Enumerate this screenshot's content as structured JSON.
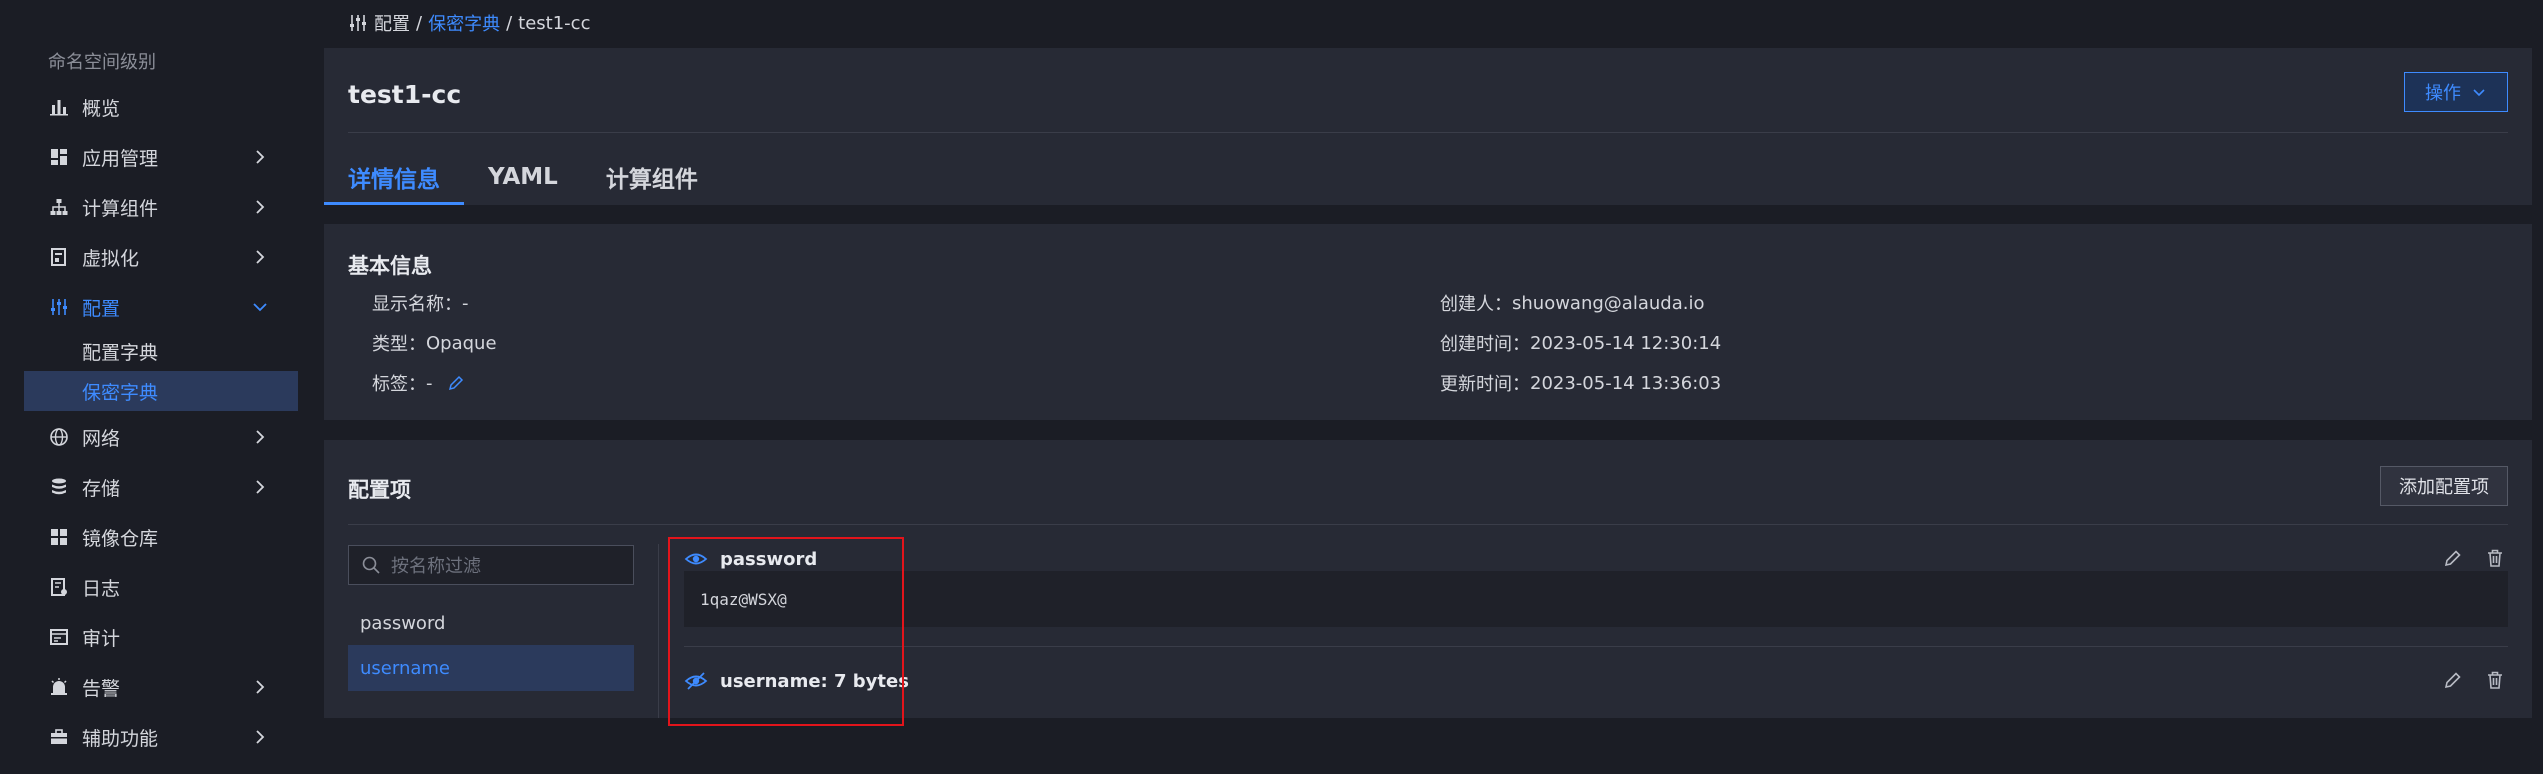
{
  "sidebar": {
    "section_title": "命名空间级别",
    "items": [
      {
        "label": "概览",
        "icon": "bar-chart-icon",
        "has_children": false
      },
      {
        "label": "应用管理",
        "icon": "apps-icon",
        "has_children": true
      },
      {
        "label": "计算组件",
        "icon": "hierarchy-icon",
        "has_children": true
      },
      {
        "label": "虚拟化",
        "icon": "virtualization-icon",
        "has_children": true
      },
      {
        "label": "配置",
        "icon": "sliders-icon",
        "has_children": true,
        "expanded": true,
        "active": true
      },
      {
        "label": "网络",
        "icon": "globe-icon",
        "has_children": true
      },
      {
        "label": "存储",
        "icon": "database-icon",
        "has_children": true
      },
      {
        "label": "镜像仓库",
        "icon": "grid-icon",
        "has_children": false
      },
      {
        "label": "日志",
        "icon": "log-icon",
        "has_children": false
      },
      {
        "label": "审计",
        "icon": "audit-icon",
        "has_children": false
      },
      {
        "label": "告警",
        "icon": "alarm-icon",
        "has_children": true
      },
      {
        "label": "辅助功能",
        "icon": "toolbox-icon",
        "has_children": true
      }
    ],
    "config_children": [
      {
        "label": "配置字典",
        "selected": false
      },
      {
        "label": "保密字典",
        "selected": true
      }
    ]
  },
  "breadcrumb": {
    "root": "配置",
    "link": "保密字典",
    "current": "test1-cc",
    "separator": "/"
  },
  "header": {
    "title": "test1-cc",
    "ops_button": "操作",
    "tabs": [
      {
        "label": "详情信息",
        "active": true
      },
      {
        "label": "YAML",
        "active": false
      },
      {
        "label": "计算组件",
        "active": false
      }
    ]
  },
  "basic_info": {
    "title": "基本信息",
    "left": [
      {
        "label": "显示名称：",
        "value": "-"
      },
      {
        "label": "类型：",
        "value": "Opaque"
      },
      {
        "label": "标签：",
        "value": "-"
      }
    ],
    "right": [
      {
        "label": "创建人：",
        "value": "shuowang@alauda.io"
      },
      {
        "label": "创建时间：",
        "value": "2023-05-14 12:30:14"
      },
      {
        "label": "更新时间：",
        "value": "2023-05-14 13:36:03"
      }
    ]
  },
  "config": {
    "title": "配置项",
    "add_button": "添加配置项",
    "filter_placeholder": "按名称过滤",
    "keys": [
      {
        "label": "password",
        "selected": false
      },
      {
        "label": "username",
        "selected": true
      }
    ],
    "entries": [
      {
        "name": "password",
        "visible": true,
        "value": "1qaz@WSX@"
      },
      {
        "name": "username: 7 bytes",
        "visible": false
      }
    ]
  },
  "colors": {
    "accent": "#3e8bff",
    "background": "#1b1d25",
    "card": "#272a35",
    "highlight": "#e2141b"
  }
}
